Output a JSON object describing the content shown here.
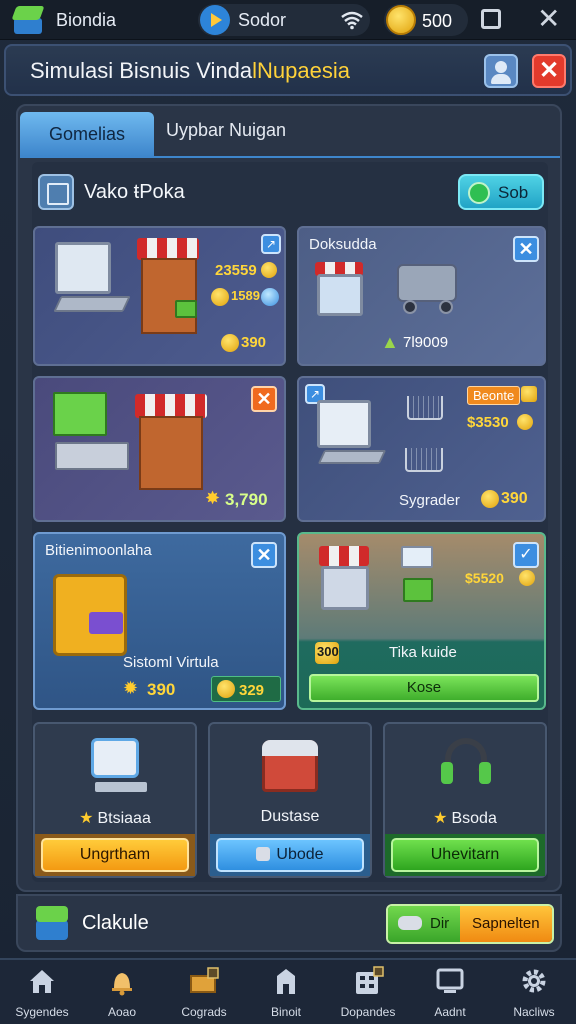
{
  "statusbar": {
    "app_name": "Biondia",
    "pill_text": "Sodor",
    "coins": "500"
  },
  "titlebar": {
    "title_main": "Simulasi Bisnuis Vinda",
    "title_highlight": "lNupaesia"
  },
  "tabs": [
    {
      "label": "Gomelias",
      "active": true
    },
    {
      "label": "Uypbar Nuigan",
      "active": false
    }
  ],
  "section": {
    "title": "Vako ŧPoka",
    "button_label": "Sob"
  },
  "cards": [
    {
      "id": "c1",
      "value_top": "23559",
      "value_mid": "1589",
      "value_bottom": "390"
    },
    {
      "id": "c2",
      "title": "Doksudda",
      "value_bottom": "7l9009"
    },
    {
      "id": "c3",
      "value_bottom": "3,790"
    },
    {
      "id": "c4",
      "tag": "Beonte",
      "value_top": "$3530",
      "label": "Sygrader",
      "value_bottom": "390"
    },
    {
      "id": "c5",
      "title": "Bitienimoonlaha",
      "label": "Sistoml Virtula",
      "value_left": "390",
      "value_right": "329"
    },
    {
      "id": "c6",
      "value_top": "$5520",
      "coins_label": "Tika kuide",
      "value_coins": "300",
      "button_label": "Kose"
    }
  ],
  "bottom_cards": [
    {
      "label": "Btsiaaa",
      "button_label": "Ungrtham",
      "star": true
    },
    {
      "label": "Dustase",
      "button_label": "Ubode",
      "star": false
    },
    {
      "label": "Bsoda",
      "button_label": "Uhevitarn",
      "star": true
    }
  ],
  "footer": {
    "title": "Clakule",
    "btn_left": "Dir",
    "btn_right": "Sapnelten"
  },
  "nav": [
    {
      "label": "Sygendes",
      "icon": "home-icon"
    },
    {
      "label": "Aoao",
      "icon": "bell-icon"
    },
    {
      "label": "Cograds",
      "icon": "crate-icon"
    },
    {
      "label": "Binoit",
      "icon": "building-icon"
    },
    {
      "label": "Dopandes",
      "icon": "calculator-icon"
    },
    {
      "label": "Aadnt",
      "icon": "monitor-icon"
    },
    {
      "label": "Nacliws",
      "icon": "gear-icon"
    }
  ]
}
